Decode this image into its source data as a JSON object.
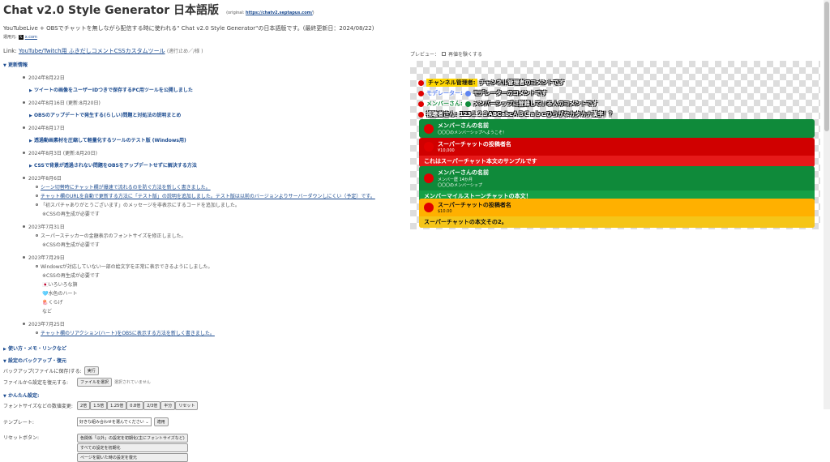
{
  "header": {
    "title": "Chat v2.0 Style Generator 日本語版",
    "original_label": "(original: ",
    "original_url": "https://chatv2.septapus.com/",
    "original_close": ")",
    "description": "YouTubeLive + OBSでチャットを無しながら配信する時に使われる\" Chat v2.0 Style Generator\"の日本語版です。(最終更新日：2024/08/22)",
    "author_label": "運用元:",
    "author_name": "x.com",
    "link_label": "Link:",
    "link_text": "YouTube/Twitch用 ふきだしコメントCSSカスタムツール",
    "link_note": "(適行止め／/様 )"
  },
  "updates": {
    "section_title": "更新情報",
    "entries": [
      {
        "date": "2024年8月22日",
        "item": "ツイートの画像をユーザーIDつきで保存するPC用ツールを公開しました"
      },
      {
        "date": "2024年8月16日 (更新:8月20日)",
        "item": "OBSのアップデートで発生する(らしい)問題と対処法の説明まとめ"
      },
      {
        "date": "2024年8月17日",
        "item": "透過動画素材を圧縮して軽量化するツールのテスト版 (Windows用)"
      },
      {
        "date": "2024年8月3日 (更新:8月20日)",
        "item": "CSSで背景が透過されない問題をOBSをアップデートせずに解決する方法"
      }
    ],
    "d2023_0806": "2023年8月6日",
    "l0806_1": "シーン切替時にチャット欄が爆速で流れるのを防ぐ方法を新しく書きました。",
    "l0806_2": "チャット欄のURLを自動で更新する方法に「テスト版」の説明を追加しました。テスト版は以前のバージョンよりサーバーダウンしにくい（予定）です。",
    "l0806_3": "「初スパチャありがとうございます」のメッセージを非表示にするコードを追加しました。",
    "l0806_4": "※CSSの再生成が必要です",
    "d2023_0731": "2023年7月31日",
    "l0731_1": "スーパーステッカーの金額表示のフォントサイズを修正しました。",
    "l0731_2": "※CSSの再生成が必要です",
    "d2023_0729": "2023年7月29日",
    "l0729_1": "Windowsが対応していない一部の絵文字を正常に表示できるようにしました。",
    "l0729_2": "※CSSの再生成が必要です",
    "l0729_3": "🇯🇵いろいろな旗",
    "l0729_4": "🩵水色のハート",
    "l0729_5": "🪼くらげ",
    "l0729_6": "など",
    "d2023_0725": "2023年7月25日",
    "l0725_1": "チャット欄のリアクション(ハート)をOBSに表示する方法を新しく書きました。"
  },
  "sections": {
    "howto": "使い方・メモ・リンクなど",
    "backup": "設定のバックアップ・復元",
    "backup_save_label": "バックアップ(ファイルに保存)する:",
    "backup_save_btn": "実行",
    "backup_restore_label": "ファイルから設定を復元する:",
    "backup_file_btn": "ファイルを選択",
    "backup_file_none": "選択されていません",
    "easy": "かんたん設定:",
    "fontsize_label": "フォントサイズなどの数値変更:",
    "fontsize_btns": [
      "2倍",
      "1.5倍",
      "1.25倍",
      "0.8倍",
      "2/3倍",
      "半分",
      "リセット"
    ],
    "template_label": "テンプレート:",
    "template_select": "好きな組み合わせを選んでください",
    "template_apply": "適用",
    "reset_label": "リセットボタン:",
    "reset_btn1": "色関係「以外」の設定を初期化(主にフォントサイズなど)",
    "reset_btn2": "すべての設定を初期化",
    "reset_btn3": "ページを開いた時の設定を復元"
  },
  "preview": {
    "label": "プレビュー：",
    "checkbox_label": "再値を験くする",
    "line1_name": "チャンネル管理者:",
    "line1_text": "チャンネル管理者のコメントです",
    "line2_name": "モデレーター:",
    "line2_text": "モデレーターのコメントです",
    "line3_name": "メンバーさん:",
    "line3_text": "メンバーシップに登録している人のコメントです",
    "line4_name": "視聴者さん:",
    "line4_text": "123１２３ABCabcＡＢＣａｂｃひらがなカタカナ漢字！？",
    "card1_name": "メンバーさんの名前",
    "card1_sub": "〇〇〇のメンバーシップへようこそ！",
    "card2_name": "スーパーチャットの投稿者名",
    "card2_amount": "¥10,000",
    "card2_body": "これはスーパーチャット本文のサンプルです",
    "card3_name": "メンバーさんの名前",
    "card3_sub1": "メンバー歴 14か月",
    "card3_sub2": "〇〇〇のメンバーシップ",
    "card3_body": "メンバーマイルストーンチャットの本文！",
    "card4_name": "スーパーチャットの投稿者名",
    "card4_amount": "$10.00",
    "card4_body": "スーパーチャットの本文その2。"
  },
  "colors": {
    "link": "#1a4a8f",
    "member_green": "#0f8a3a",
    "superchat_red": "#d00000",
    "superchat_red_dark": "#e61919",
    "superchat_orange": "#ffb000",
    "superchat_orange_dark": "#f5c518",
    "owner_yellow": "#ffd600",
    "moderator_blue": "#5e84f1"
  }
}
